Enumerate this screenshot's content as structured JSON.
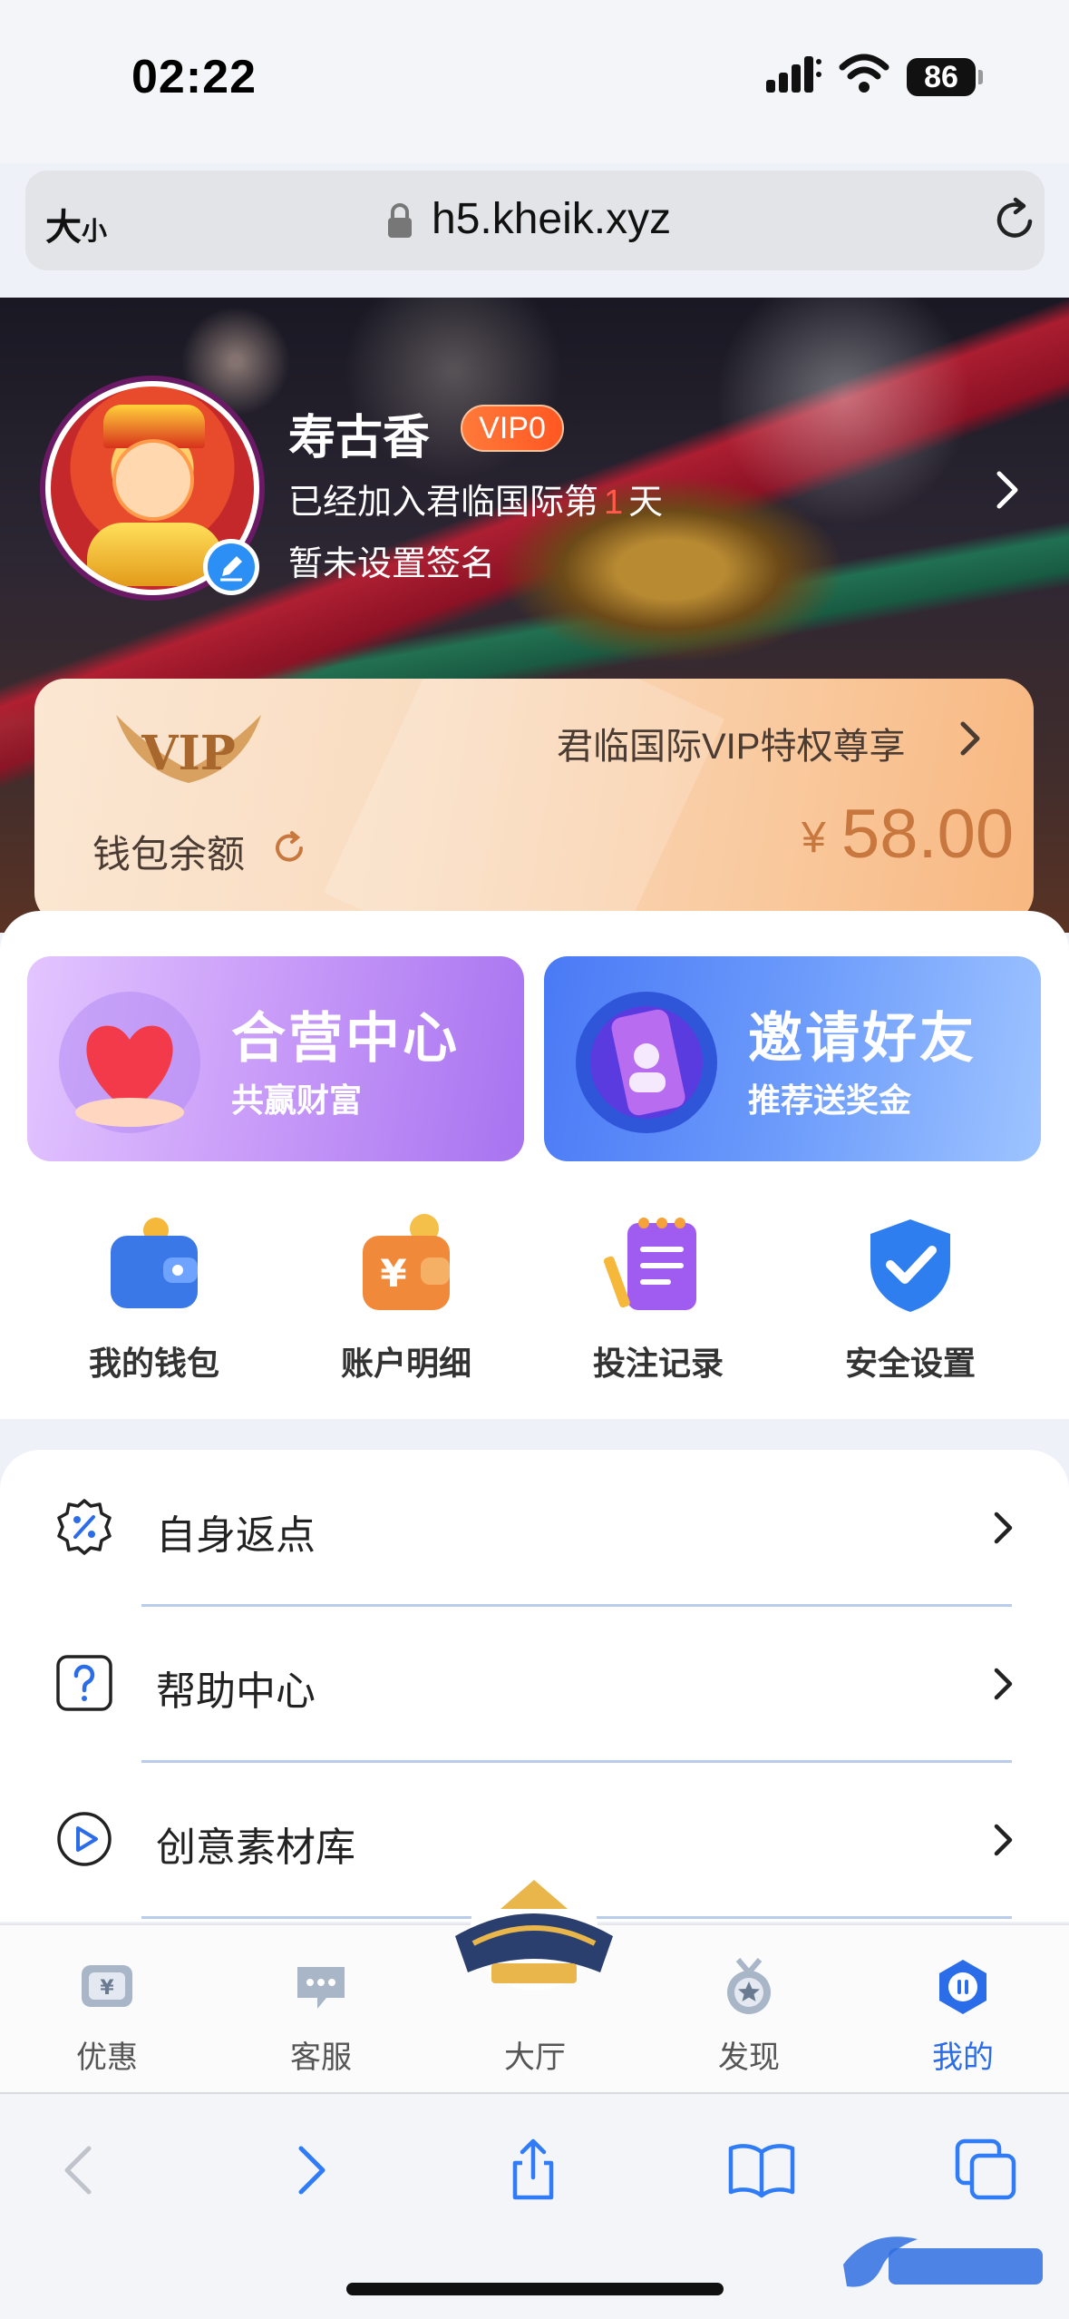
{
  "status_bar": {
    "time": "02:22",
    "battery": "86"
  },
  "url_bar": {
    "text_size_label_big": "大",
    "text_size_label_small": "小",
    "url": "h5.kheik.xyz"
  },
  "profile": {
    "username": "寿古香",
    "vip_level": "VIP0",
    "join_prefix": "已经加入君临国际第",
    "join_days": "1",
    "join_suffix": "天",
    "signature": "暂未设置签名"
  },
  "vip_card": {
    "privilege_link": "君临国际VIP特权尊享",
    "wallet_label": "钱包余额",
    "currency_symbol": "¥",
    "balance": "58.00"
  },
  "promos": [
    {
      "title": "合营中心",
      "subtitle": "共赢财富"
    },
    {
      "title": "邀请好友",
      "subtitle": "推荐送奖金"
    }
  ],
  "quick_actions": [
    {
      "label": "我的钱包",
      "icon": "wallet-icon"
    },
    {
      "label": "账户明细",
      "icon": "account-details-icon"
    },
    {
      "label": "投注记录",
      "icon": "bet-records-icon"
    },
    {
      "label": "安全设置",
      "icon": "security-shield-icon"
    }
  ],
  "menu": [
    {
      "label": "自身返点",
      "icon": "rebate-percent-icon"
    },
    {
      "label": "帮助中心",
      "icon": "help-question-icon"
    },
    {
      "label": "创意素材库",
      "icon": "play-circle-icon"
    }
  ],
  "tabbar": [
    {
      "label": "优惠",
      "icon": "promo-ticket-icon"
    },
    {
      "label": "客服",
      "icon": "chat-bubble-icon"
    },
    {
      "label": "大厅",
      "icon": "hall-logo-icon"
    },
    {
      "label": "发现",
      "icon": "medal-star-icon"
    },
    {
      "label": "我的",
      "icon": "profile-icon",
      "active": true
    }
  ],
  "colors": {
    "accent_blue": "#2b6de8",
    "vip_orange": "#ff5722",
    "balance_gold": "#c8773e"
  }
}
